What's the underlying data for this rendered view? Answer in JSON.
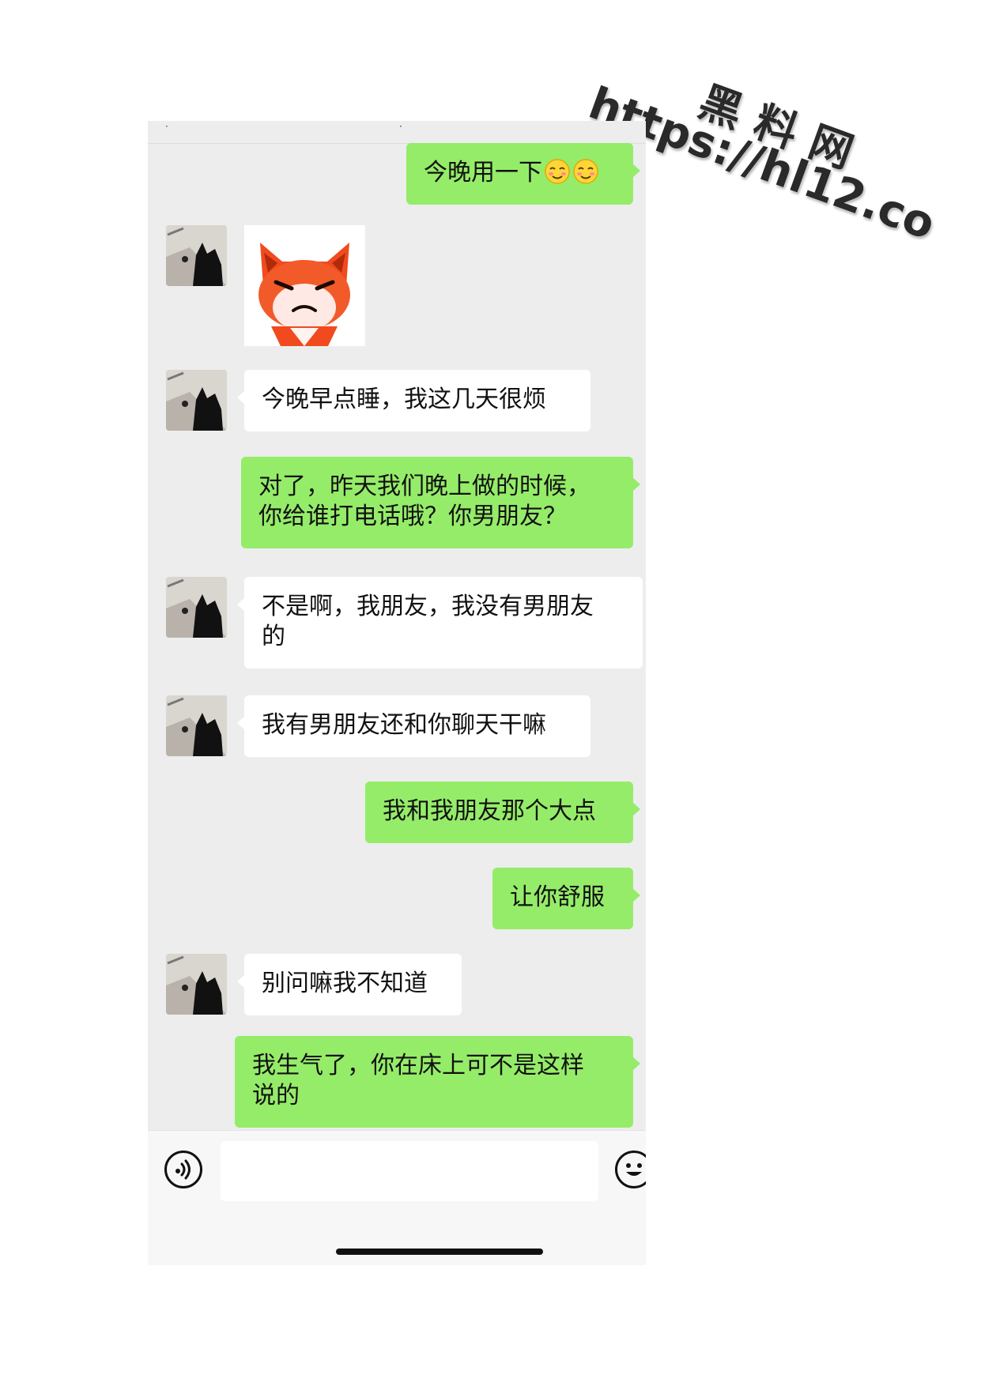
{
  "watermark": {
    "line1": "黑料网",
    "line2": "https://hl12.co"
  },
  "colors": {
    "sent_bubble": "#95ec69",
    "received_bubble": "#ffffff",
    "chat_background": "#ededed"
  },
  "messages": [
    {
      "side": "right",
      "type": "text",
      "text": "今晚用一下",
      "emojis": [
        "smiling-blush-emoji",
        "smiling-blush-emoji"
      ]
    },
    {
      "side": "left",
      "type": "sticker",
      "sticker": "angry-fox-sticker"
    },
    {
      "side": "left",
      "type": "text",
      "text": "今晚早点睡，我这几天很烦"
    },
    {
      "side": "right",
      "type": "text",
      "text": "对了，昨天我们晚上做的时候，你给谁打电话哦？你男朋友？",
      "lines": [
        "对了，昨天我们晚上做的时候，",
        "你给谁打电话哦？你男朋友？"
      ]
    },
    {
      "side": "left",
      "type": "text",
      "text": "不是啊，我朋友，我没有男朋友的",
      "lines": [
        "不是啊，我朋友，我没有男朋友",
        "的"
      ]
    },
    {
      "side": "left",
      "type": "text",
      "text": "我有男朋友还和你聊天干嘛"
    },
    {
      "side": "right",
      "type": "text",
      "text": "我和我朋友那个大点"
    },
    {
      "side": "right",
      "type": "text",
      "text": "让你舒服"
    },
    {
      "side": "left",
      "type": "text",
      "text": "别问嘛我不知道"
    },
    {
      "side": "right",
      "type": "text",
      "text": "我生气了，你在床上可不是这样说的",
      "lines": [
        "我生气了，你在床上可不是这样",
        "说的"
      ]
    }
  ],
  "input_bar": {
    "voice_icon": "voice-icon",
    "input_value": "",
    "emoji_icon": "emoji-icon"
  }
}
